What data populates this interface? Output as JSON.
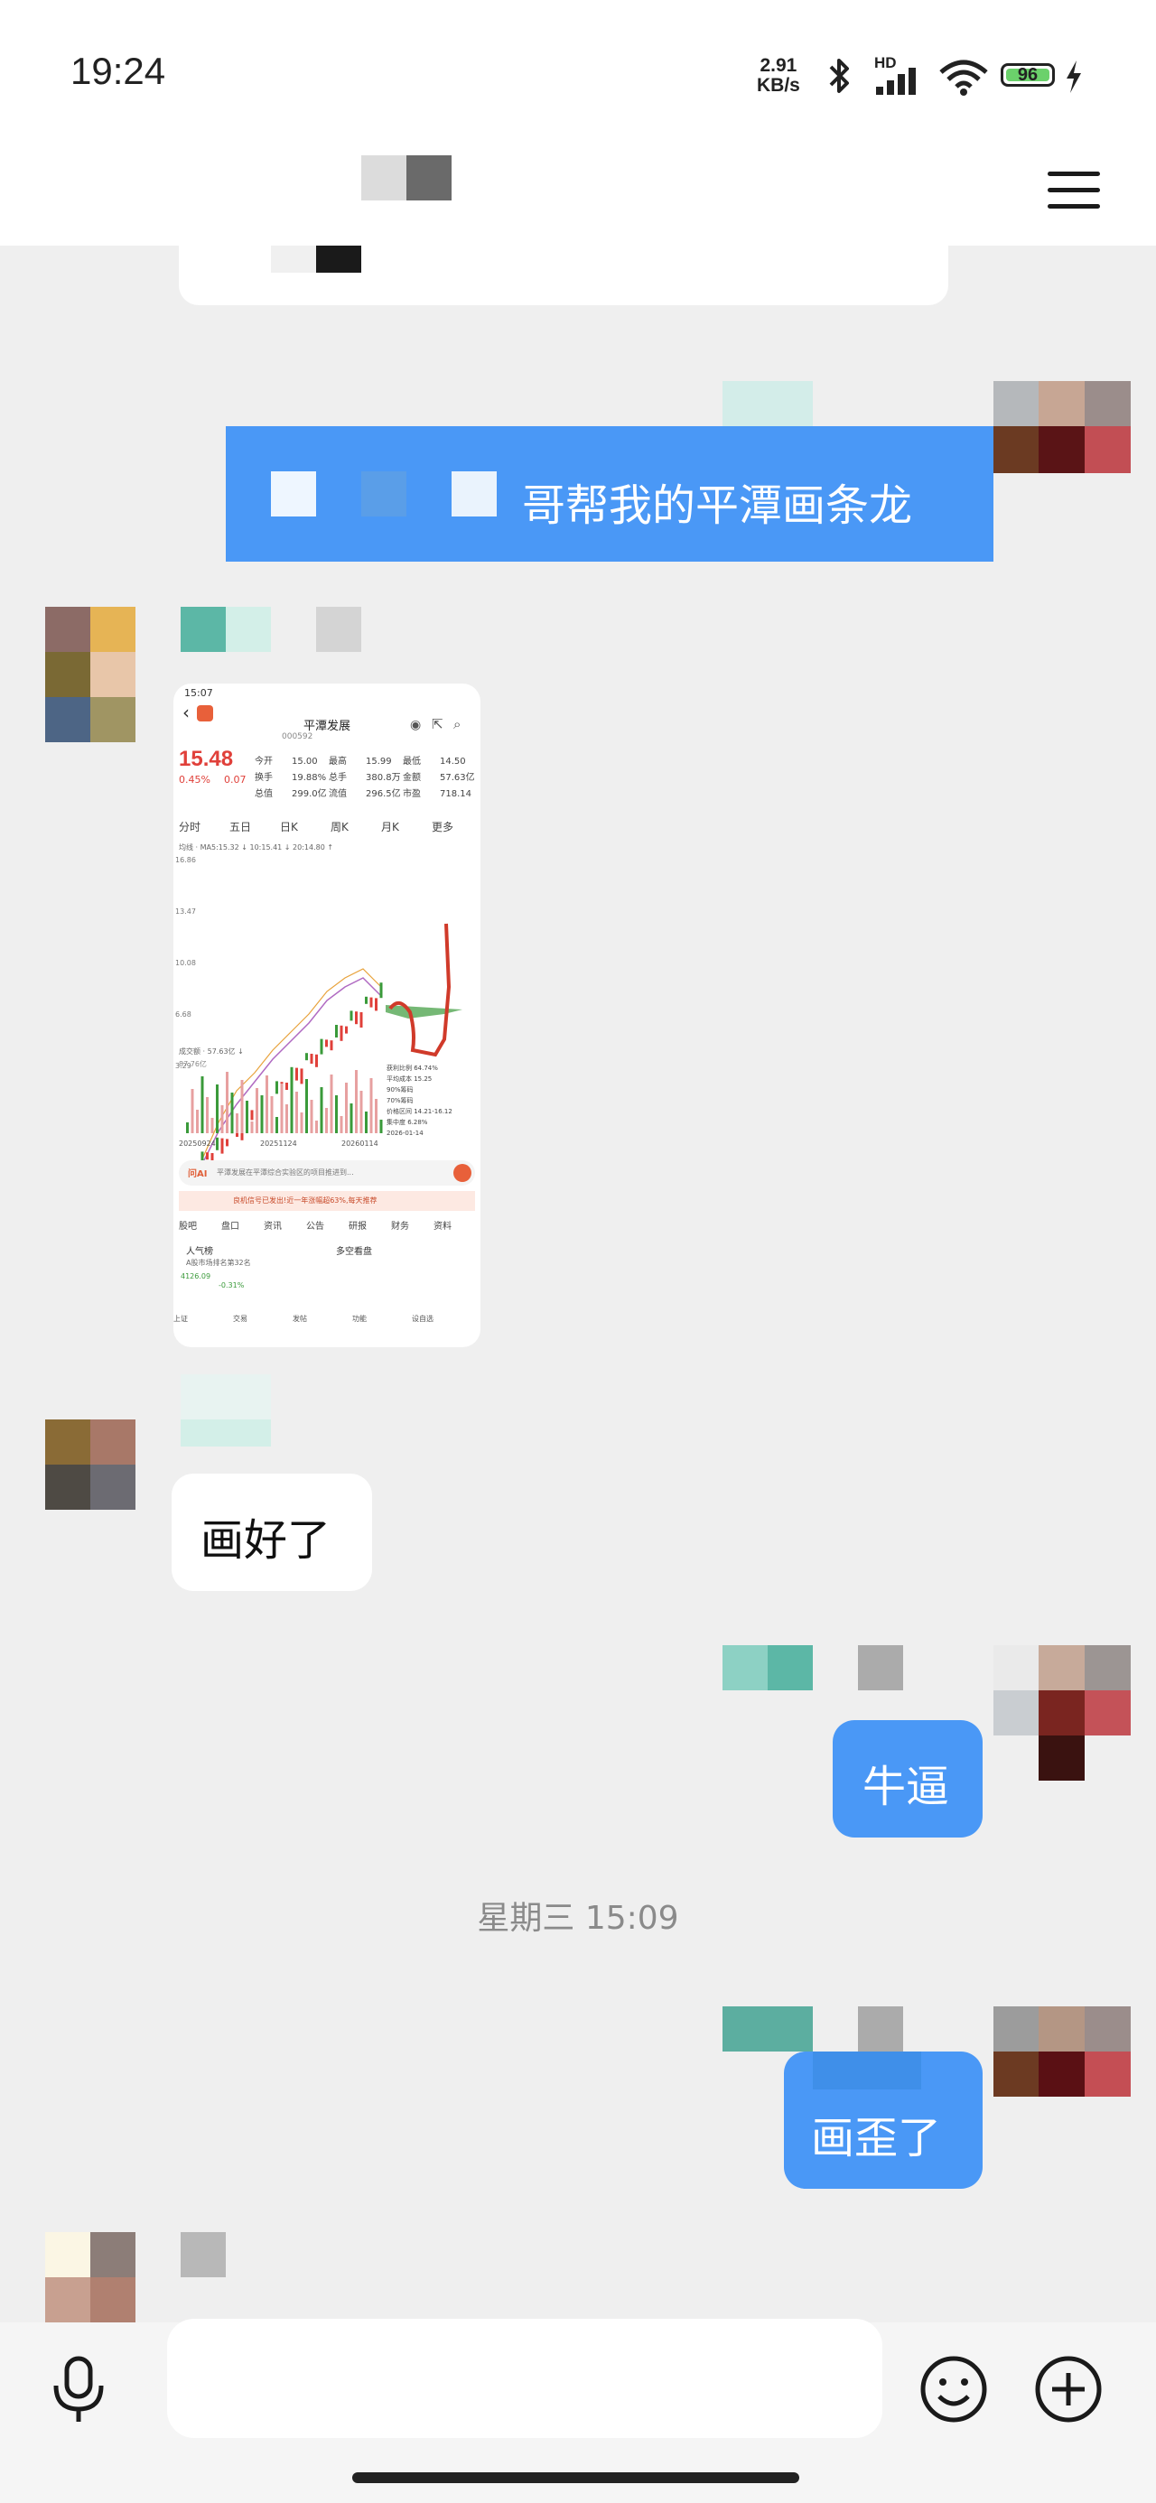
{
  "status_bar": {
    "time": "19:24",
    "net_speed_value": "2.91",
    "net_speed_unit": "KB/s",
    "network_label": "HD",
    "battery": "96"
  },
  "messages": {
    "request_text": "哥帮我的平潭画条龙",
    "reply_text": "画好了",
    "cheer_text": "牛逼",
    "complaint_text": "画歪了"
  },
  "date_separator": "星期三 15:09",
  "stock_shot": {
    "time": "15:07",
    "name": "平潭发展",
    "code": "000592",
    "price": "15.48",
    "change_pct": "0.45%",
    "change": "0.07",
    "stats_row1": [
      "今开",
      "15.00",
      "最高",
      "15.99",
      "最低",
      "14.50"
    ],
    "stats_row2": [
      "换手",
      "19.88%",
      "总手",
      "380.8万",
      "金额",
      "57.63亿"
    ],
    "stats_row3": [
      "总值",
      "299.0亿",
      "流值",
      "296.5亿",
      "市盈",
      "718.14"
    ],
    "tabs": [
      "分时",
      "五日",
      "日K",
      "周K",
      "月K",
      "更多"
    ],
    "ma_line": "均线 · MA5:15.32 ↓  10:15.41 ↓  20:14.80 ↑",
    "y_labels": [
      "16.86",
      "13.47",
      "10.08",
      "6.68",
      "3.29"
    ],
    "vol_label": "成交额 · 57.63亿 ↓",
    "vol_max": "87.76亿",
    "dates": [
      "20250924",
      "20251124",
      "20260114"
    ],
    "chip_title": "筹码分布",
    "chip_stats": [
      "获利比例 64.74%",
      "平均成本 15.25",
      "90%筹码",
      "70%筹码",
      "价格区间 14.21-16.12",
      "集中度 6.28%",
      "2026-01-14"
    ],
    "ai_prompt": "平潭发展在平潭综合实验区的项目推进到...",
    "banner": "良机信号已发出!近一年涨幅超63%,每天推荐",
    "bottom_tabs": [
      "股吧",
      "盘口",
      "资讯",
      "公告",
      "研报",
      "财务",
      "资料"
    ],
    "hot_label": "人气榜",
    "hot_sub": "A股市场排名第32名",
    "bull_bear": "多空看盘",
    "nav": [
      "上证",
      "交易",
      "发帖",
      "功能",
      "设自选"
    ],
    "index_value": "4126.09",
    "index_change": "-0.31%"
  },
  "colors": {
    "accent_blue": "#4a98f6",
    "chat_bg": "#efefef",
    "stock_red": "#e0403a",
    "stock_green": "#3a9a3a"
  },
  "icons": [
    "mic-icon",
    "emoji-icon",
    "plus-circle-icon",
    "menu-icon",
    "bluetooth-icon",
    "signal-icon",
    "wifi-icon",
    "charging-icon"
  ]
}
